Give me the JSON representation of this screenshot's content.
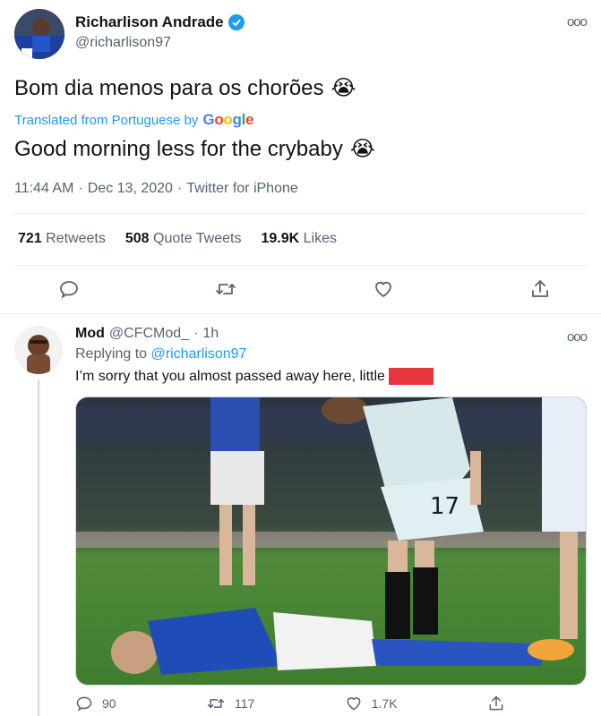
{
  "tweet": {
    "display_name": "Richarlison Andrade",
    "handle": "@richarlison97",
    "text": "Bom dia menos para os chorões",
    "emoji": "😭",
    "translated_label": "Translated from Portuguese by",
    "translator": "Google",
    "translation": "Good morning less for the crybaby",
    "time": "11:44 AM",
    "date": "Dec 13, 2020",
    "source": "Twitter for iPhone",
    "separator": "·",
    "more": "ooo",
    "stats": [
      {
        "value": "721",
        "label": "Retweets"
      },
      {
        "value": "508",
        "label": "Quote Tweets"
      },
      {
        "value": "19.9K",
        "label": "Likes"
      }
    ]
  },
  "reply": {
    "display_name": "Mod",
    "handle": "@CFCMod_",
    "separator": "·",
    "time": "1h",
    "replying_prefix": "Replying to",
    "replying_to": "@richarlison97",
    "text": "I’m sorry that you almost passed away here, little",
    "more": "ooo",
    "jersey_number": "17",
    "actions": {
      "replies": "90",
      "retweets": "117",
      "likes": "1.7K"
    }
  },
  "colors": {
    "accent": "#1d9bf0",
    "secondary_text": "#536471",
    "redaction": "#e8343b"
  }
}
